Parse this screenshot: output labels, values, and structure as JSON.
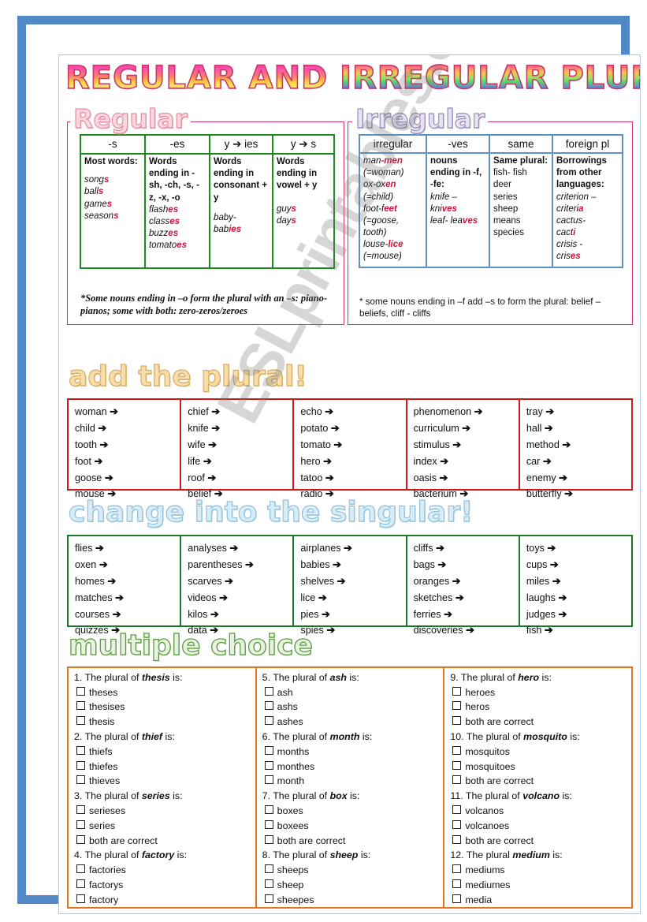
{
  "title": {
    "part1": "REGULAR AND ",
    "part2": "IRREGULAR PLURALS"
  },
  "watermark": "ESLprintables.com",
  "sections": {
    "regular_label": "Regular",
    "irregular_label": "Irregular",
    "add_plural_label": "add the plural!",
    "change_singular_label": "change into the singular!",
    "multiple_choice_label": "multiple choice"
  },
  "regular_table": {
    "headers": [
      "-s",
      "-es",
      "y ➔ ies",
      "y ➔ s"
    ],
    "columns": [
      {
        "title": "Most words:",
        "examples": [
          "songs",
          "balls",
          "games",
          "seasons"
        ],
        "suffix": "s"
      },
      {
        "title": "Words ending in -sh, -ch, -s, -z, -x, -o",
        "examples": [
          "flashes",
          "classes",
          "buzzes",
          "tomatoes"
        ],
        "suffix": "es"
      },
      {
        "title": "Words ending in consonant + y",
        "examples": [
          "baby- babies"
        ],
        "suffix": "ies"
      },
      {
        "title": "Words ending in vowel + y",
        "examples": [
          "guys",
          "days"
        ],
        "suffix": "s"
      }
    ],
    "note": "*Some nouns ending in –o form the plural with an –s: piano-pianos; some with both: zero-zeros/zeroes"
  },
  "irregular_table": {
    "headers": [
      "irregular",
      "-ves",
      "same",
      "foreign pl"
    ],
    "columns": [
      {
        "title": "",
        "examples": [
          "man-men",
          "(=woman)",
          "ox-oxen",
          "(=child)",
          "foot-feet",
          "(=goose, tooth)",
          "louse-lice",
          "(=mouse)"
        ]
      },
      {
        "title": "nouns ending in -f, -fe:",
        "examples": [
          "knife – knives",
          "leaf- leaves"
        ]
      },
      {
        "title": "Same plural:",
        "examples": [
          "fish- fish",
          "deer",
          "series",
          "sheep",
          "means",
          "species"
        ]
      },
      {
        "title": "Borrowings from other languages:",
        "examples": [
          "criterion – criteria",
          "cactus- cacti",
          "crisis - crises"
        ]
      }
    ],
    "note": "* some nouns ending in –f add –s to form the plural: belief – beliefs, cliff - cliffs"
  },
  "add_plural": {
    "arrow": "➔",
    "columns": [
      [
        "woman",
        "child",
        "tooth",
        "foot",
        "goose",
        "mouse"
      ],
      [
        "chief",
        "knife",
        "wife",
        "life",
        "roof",
        "belief"
      ],
      [
        "echo",
        "potato",
        "tomato",
        "hero",
        "tatoo",
        "radio"
      ],
      [
        "phenomenon",
        "curriculum",
        "stimulus",
        "index",
        "oasis",
        "bacterium"
      ],
      [
        "tray",
        "hall",
        "method",
        "car",
        "enemy",
        "butterfly"
      ]
    ]
  },
  "change_singular": {
    "arrow": "➔",
    "columns": [
      [
        "flies",
        "oxen",
        "homes",
        "matches",
        "courses",
        "quizzes"
      ],
      [
        "analyses",
        "parentheses",
        "scarves",
        "videos",
        "kilos",
        "data"
      ],
      [
        "airplanes",
        "babies",
        "shelves",
        "lice",
        "pies",
        "spies"
      ],
      [
        "cliffs",
        "bags",
        "oranges",
        "sketches",
        "ferries",
        "discoveries"
      ],
      [
        "toys",
        "cups",
        "miles",
        "laughs",
        "judges",
        "fish"
      ]
    ]
  },
  "multiple_choice": {
    "columns": [
      [
        {
          "n": "1.",
          "pre": "The plural of ",
          "word": "thesis",
          "post": " is:",
          "options": [
            "theses",
            "thesises",
            "thesis"
          ]
        },
        {
          "n": "2.",
          "pre": "The plural of ",
          "word": "thief",
          "post": " is:",
          "options": [
            "thiefs",
            "thiefes",
            "thieves"
          ]
        },
        {
          "n": "3.",
          "pre": "The plural of ",
          "word": "series",
          "post": " is:",
          "options": [
            "serieses",
            "series",
            "both are correct"
          ]
        },
        {
          "n": "4.",
          "pre": "The plural of ",
          "word": "factory",
          "post": " is:",
          "options": [
            "factories",
            "factorys",
            "factory"
          ]
        }
      ],
      [
        {
          "n": "5.",
          "pre": "The plural of ",
          "word": "ash",
          "post": " is:",
          "options": [
            "ash",
            "ashs",
            "ashes"
          ]
        },
        {
          "n": "6.",
          "pre": "The plural of ",
          "word": "month",
          "post": " is:",
          "options": [
            "months",
            "monthes",
            "month"
          ]
        },
        {
          "n": "7.",
          "pre": "The plural of ",
          "word": "box",
          "post": " is:",
          "options": [
            "boxes",
            "boxees",
            "both are correct"
          ]
        },
        {
          "n": "8.",
          "pre": "The plural of ",
          "word": "sheep",
          "post": " is:",
          "options": [
            "sheeps",
            "sheep",
            "sheepes"
          ]
        }
      ],
      [
        {
          "n": "9.",
          "pre": "The plural of ",
          "word": "hero",
          "post": " is:",
          "options": [
            "heroes",
            "heros",
            "both are correct"
          ]
        },
        {
          "n": "10.",
          "pre": "The plural of ",
          "word": "mosquito",
          "post": " is:",
          "options": [
            "mosquitos",
            "mosquitoes",
            "both are correct"
          ]
        },
        {
          "n": "11.",
          "pre": "The plural of ",
          "word": "volcano",
          "post": " is:",
          "options": [
            "volcanos",
            "volcanoes",
            "both are correct"
          ]
        },
        {
          "n": "12.",
          "pre": "The plural ",
          "word": "medium",
          "post": " is:",
          "options": [
            "mediums",
            "mediumes",
            "media"
          ]
        }
      ]
    ]
  },
  "colors": {
    "frame_blue": "#5189c8",
    "pink": "#d6336c",
    "green": "#1f8a1f",
    "blue_table": "#5e90c4",
    "red": "#d01919",
    "orange": "#e3761a",
    "accent_red_text": "#d2123c"
  }
}
